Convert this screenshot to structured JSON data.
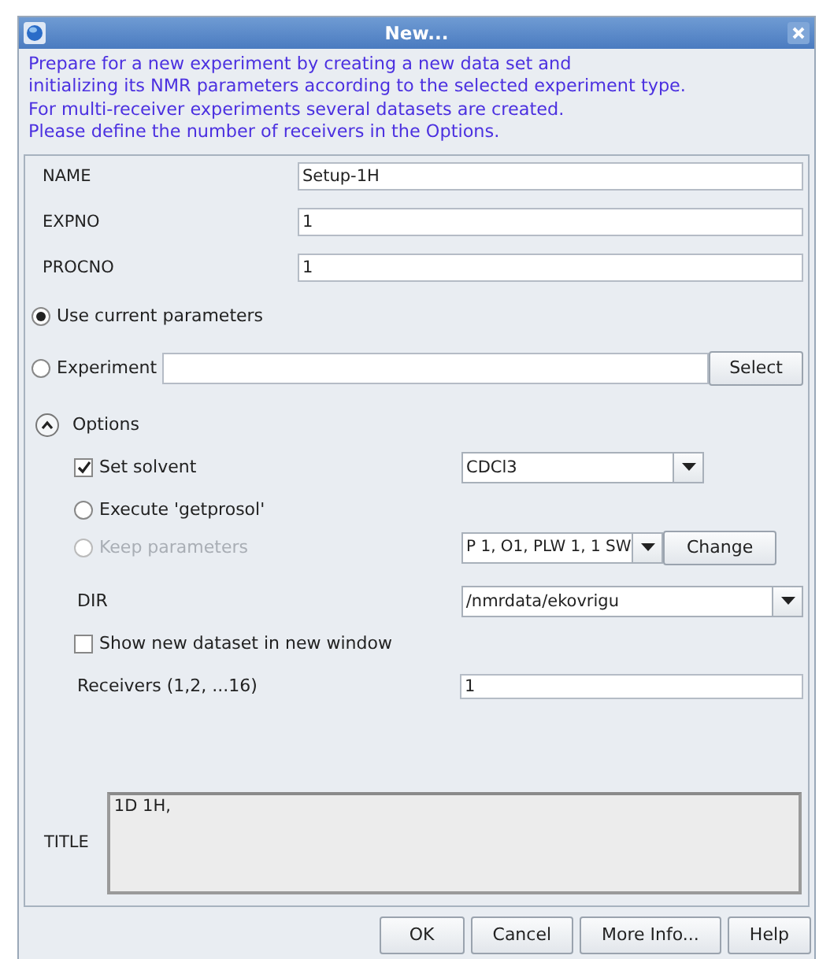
{
  "window": {
    "title": "New..."
  },
  "intro": [
    "Prepare for a new experiment by creating a new data set and",
    "initializing its NMR parameters according to the selected experiment type.",
    "For multi-receiver experiments several datasets are created.",
    "Please define the number of receivers in the Options."
  ],
  "fields": [
    {
      "label": "NAME",
      "value": "Setup-1H"
    },
    {
      "label": "EXPNO",
      "value": "1"
    },
    {
      "label": "PROCNO",
      "value": "1"
    }
  ],
  "source": [
    {
      "kind": "plain",
      "label": "Use current parameters",
      "selected": true
    },
    {
      "kind": "field",
      "label": "Experiment",
      "selected": false,
      "button": "Select"
    }
  ],
  "options": {
    "label": "Options",
    "expanded": true,
    "rows": [
      {
        "kind": "checkbox",
        "label": "Set solvent",
        "checked": true,
        "dropdown": "CDCl3"
      },
      {
        "kind": "radio",
        "label": "Execute 'getprosol'",
        "selected": false,
        "disabled": false
      },
      {
        "kind": "radio",
        "label": "Keep parameters",
        "selected": false,
        "disabled": true,
        "dropdown": "P 1, O1, PLW 1, 1 SW",
        "button": "Change"
      },
      {
        "kind": "dir",
        "label": "DIR",
        "dropdown": "/nmrdata/ekovrigu"
      },
      {
        "kind": "checkbox",
        "label": "Show new dataset in new window",
        "checked": false
      },
      {
        "kind": "field",
        "label": "Receivers (1,2, ...16)",
        "value": "1"
      }
    ]
  },
  "title_field": {
    "label": "TITLE",
    "value": "1D 1H,"
  },
  "buttons": [
    "OK",
    "Cancel",
    "More Info...",
    "Help"
  ]
}
